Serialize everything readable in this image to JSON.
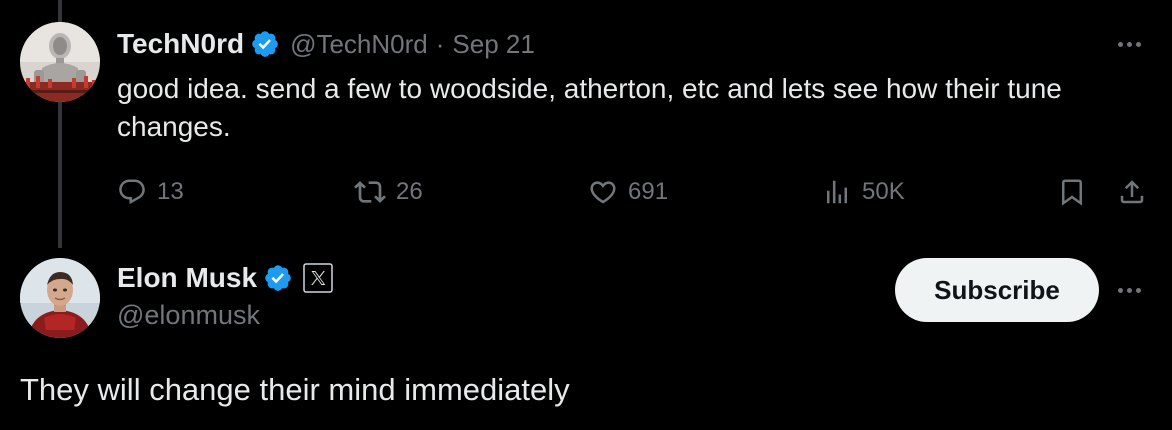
{
  "reply_tweet": {
    "author_name": "TechN0rd",
    "author_handle": "@TechN0rd",
    "separator": "·",
    "date": "Sep 21",
    "text": "good idea. send a few to woodside, atherton, etc and lets see how their tune changes.",
    "avatar_icon": "robot-chess-avatar",
    "actions": {
      "replies": "13",
      "reposts": "26",
      "likes": "691",
      "views": "50K"
    }
  },
  "main_tweet": {
    "author_name": "Elon Musk",
    "author_handle": "@elonmusk",
    "affiliate_badge_icon": "x-logo-icon",
    "avatar_icon": "person-avatar",
    "subscribe_label": "Subscribe",
    "text": "They will change their mind immediately"
  },
  "colors": {
    "background": "#000000",
    "primary_text": "#e7e9ea",
    "secondary_text": "#71767b",
    "verified_blue": "#1d9bf0",
    "subscribe_bg": "#eff3f4",
    "thread_line": "#333639"
  }
}
